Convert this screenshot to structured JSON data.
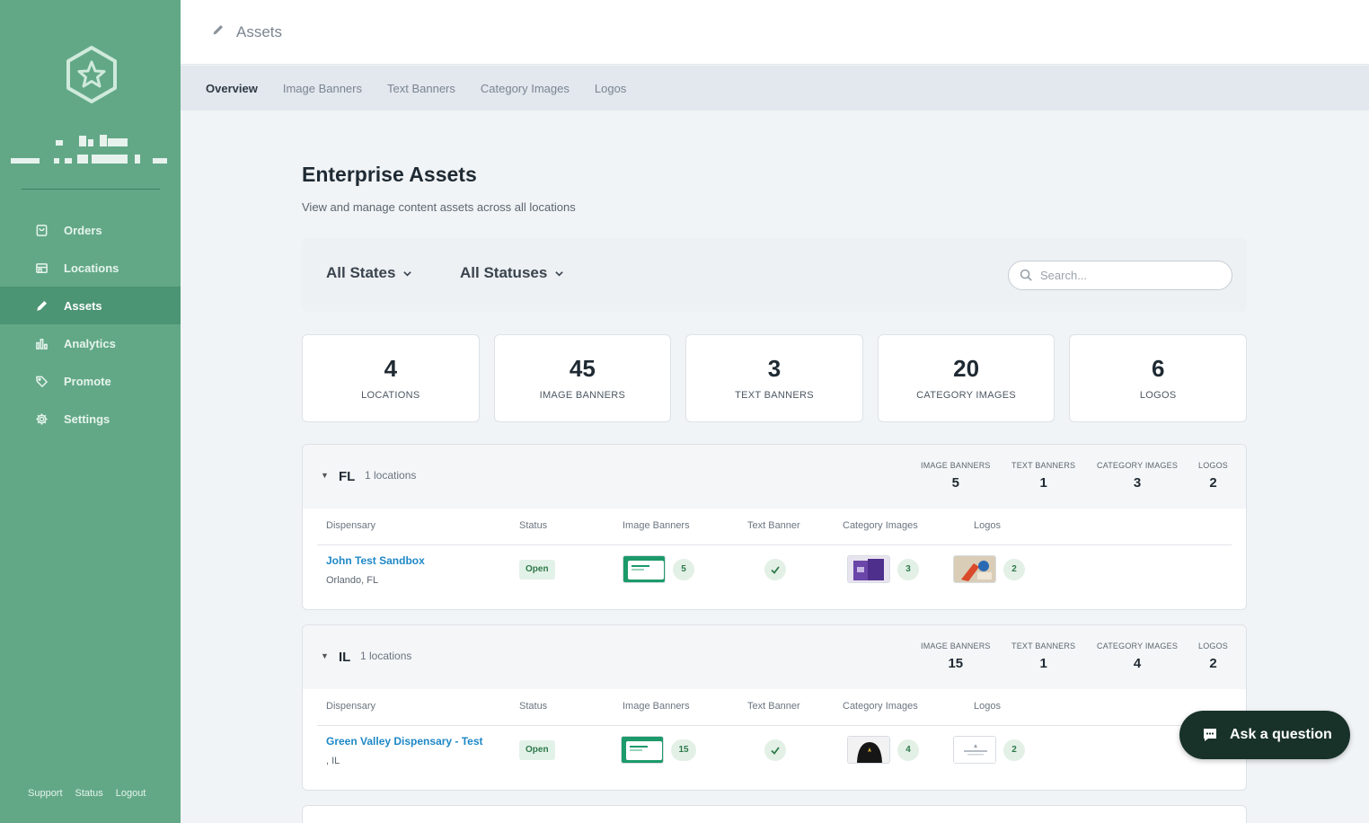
{
  "header": {
    "title": "Assets",
    "icon": "pencil-icon"
  },
  "sidebar": {
    "items": [
      {
        "label": "Orders",
        "icon": "bag-icon"
      },
      {
        "label": "Locations",
        "icon": "store-icon"
      },
      {
        "label": "Assets",
        "icon": "pencil-icon",
        "active": true
      },
      {
        "label": "Analytics",
        "icon": "bar-chart-icon"
      },
      {
        "label": "Promote",
        "icon": "tag-icon"
      },
      {
        "label": "Settings",
        "icon": "gear-icon"
      }
    ],
    "footer": [
      "Support",
      "Status",
      "Logout"
    ]
  },
  "tabs": [
    "Overview",
    "Image Banners",
    "Text Banners",
    "Category Images",
    "Logos"
  ],
  "page": {
    "title": "Enterprise Assets",
    "subtitle": "View and manage content assets across all locations"
  },
  "filters": {
    "state": "All States",
    "status": "All Statuses",
    "search_placeholder": "Search..."
  },
  "stats": [
    {
      "value": "4",
      "label": "LOCATIONS"
    },
    {
      "value": "45",
      "label": "IMAGE BANNERS"
    },
    {
      "value": "3",
      "label": "TEXT BANNERS"
    },
    {
      "value": "20",
      "label": "CATEGORY IMAGES"
    },
    {
      "value": "6",
      "label": "LOGOS"
    }
  ],
  "metric_labels": [
    "IMAGE BANNERS",
    "TEXT BANNERS",
    "CATEGORY IMAGES",
    "LOGOS"
  ],
  "table_columns": [
    "Dispensary",
    "Status",
    "Image Banners",
    "Text Banner",
    "Category Images",
    "Logos"
  ],
  "states": [
    {
      "code": "FL",
      "count": "1 locations",
      "metrics": [
        "5",
        "1",
        "3",
        "2"
      ],
      "rows": [
        {
          "name": "John Test Sandbox",
          "city": "Orlando, FL",
          "status": "Open",
          "image_banners": "5",
          "category_images": "3",
          "logos": "2"
        }
      ]
    },
    {
      "code": "IL",
      "count": "1 locations",
      "metrics": [
        "15",
        "1",
        "4",
        "2"
      ],
      "rows": [
        {
          "name": "Green Valley Dispensary - Test",
          "city": ", IL",
          "status": "Open",
          "image_banners": "15",
          "category_images": "4",
          "logos": "2"
        }
      ]
    }
  ],
  "chat": {
    "label": "Ask a question",
    "icon": "chat-icon"
  },
  "colors": {
    "sidebar": "#62a887",
    "sidebar_active": "#4b9474",
    "link": "#1e88c7",
    "chat": "#18322a"
  }
}
